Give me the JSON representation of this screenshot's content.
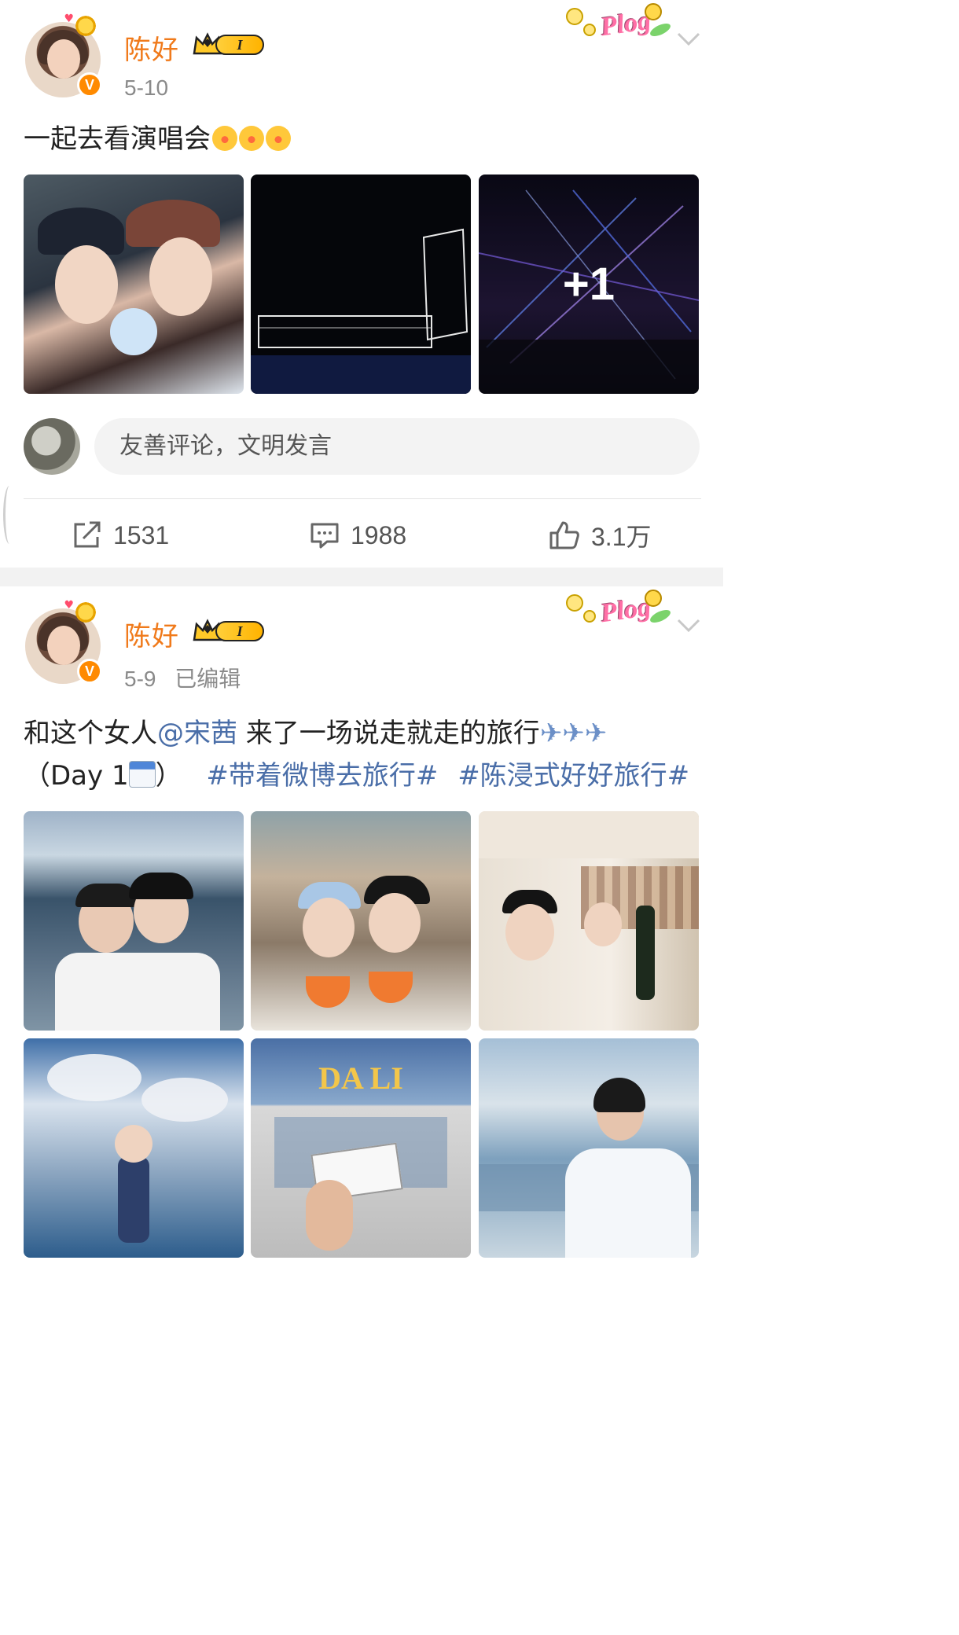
{
  "posts": [
    {
      "user": {
        "name": "陈好",
        "level": "I"
      },
      "date": "5-10",
      "edited": "",
      "text": "一起去看演唱会",
      "emoji_count": 3,
      "more_photos": "+1",
      "comment_placeholder": "友善评论，文明发言",
      "actions": {
        "repost": "1531",
        "comment": "1988",
        "like": "3.1万"
      }
    },
    {
      "user": {
        "name": "陈好",
        "level": "I"
      },
      "date": "5-9",
      "edited": "已编辑",
      "text_line1_a": "和这个女人",
      "mention": "@宋茜",
      "text_line1_b": " 来了一场说走就走的旅行",
      "text_line2_a": "（Day 1",
      "text_line2_b": "）",
      "hashtags": [
        "#带着微博去旅行#",
        "#陈浸式好好旅行#"
      ],
      "photo_sign": "DA LI"
    }
  ],
  "badges": {
    "plog": "Plog"
  },
  "icons": [
    "share-icon",
    "comment-icon",
    "like-icon",
    "chevron-down-icon",
    "verified-badge-icon",
    "crown-icon"
  ],
  "colors": {
    "name": "#f07a1b",
    "link": "#4a6ea8",
    "meta": "#8a8a8a",
    "verified": "#ff8a00"
  }
}
